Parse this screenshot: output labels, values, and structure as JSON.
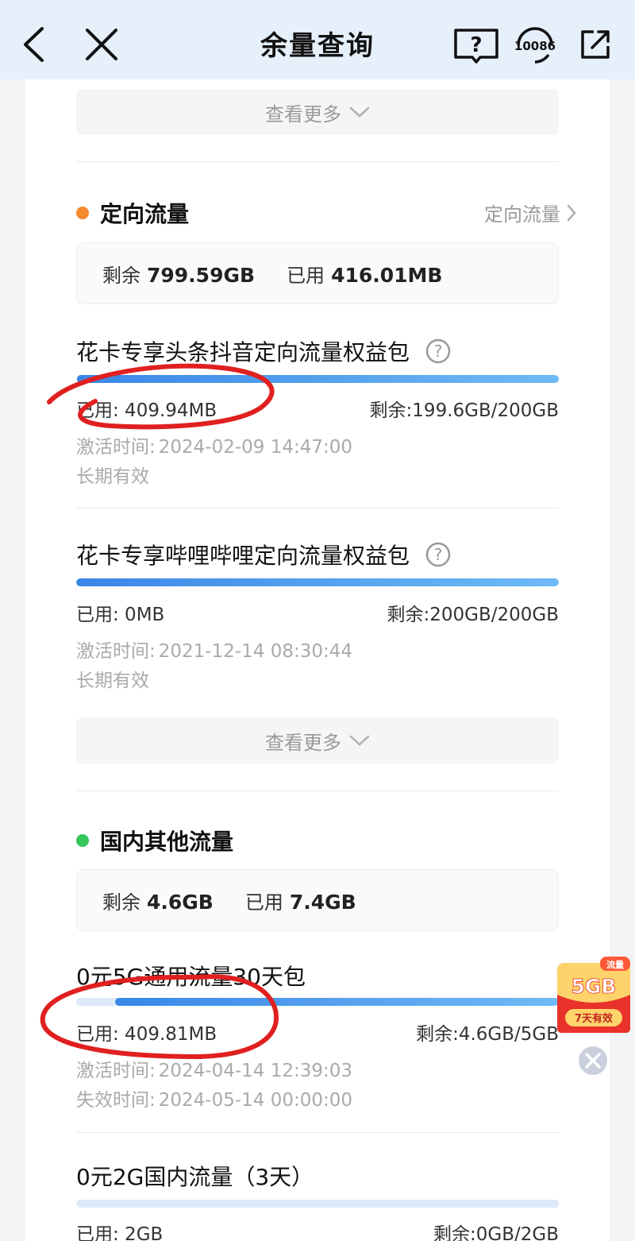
{
  "header": {
    "title": "余量查询",
    "hotline_label": "10086",
    "back_icon": "back-arrow-icon",
    "close_icon": "close-icon",
    "help_icon": "help-book-icon",
    "share_icon": "share-icon"
  },
  "view_more_label": "查看更多",
  "directional": {
    "title": "定向流量",
    "dot_color": "#f5892e",
    "link_label": "定向流量",
    "summary": {
      "remain_label": "剩余",
      "remain_value": "799.59GB",
      "used_label": "已用",
      "used_value": "416.01MB"
    },
    "packages": [
      {
        "name": "花卡专享头条抖音定向流量权益包",
        "used_text": "已用: 409.94MB",
        "remain_text": "剩余:199.6GB/200GB",
        "remaining_fraction": 0.998,
        "meta1_label": "激活时间:",
        "meta1_value": "2024-02-09 14:47:00",
        "meta2": "长期有效"
      },
      {
        "name": "花卡专享哔哩哔哩定向流量权益包",
        "used_text": "已用: 0MB",
        "remain_text": "剩余:200GB/200GB",
        "remaining_fraction": 1.0,
        "meta1_label": "激活时间:",
        "meta1_value": "2021-12-14 08:30:44",
        "meta2": "长期有效"
      }
    ]
  },
  "domestic": {
    "title": "国内其他流量",
    "dot_color": "#34c759",
    "summary": {
      "remain_label": "剩余",
      "remain_value": "4.6GB",
      "used_label": "已用",
      "used_value": "7.4GB"
    },
    "packages": [
      {
        "name": "0元5G通用流量30天包",
        "used_text": "已用: 409.81MB",
        "remain_text": "剩余:4.6GB/5GB",
        "remaining_fraction": 0.92,
        "meta1_label": "激活时间:",
        "meta1_value": "2024-04-14 12:39:03",
        "meta2_label": "失效时间:",
        "meta2_value": "2024-05-14 00:00:00"
      },
      {
        "name": "0元2G国内流量（3天）",
        "used_text": "已用: 2GB",
        "remain_text": "剩余:0GB/2GB",
        "remaining_fraction": 0.0
      }
    ]
  },
  "promo": {
    "tag": "流量",
    "amount": "5GB",
    "validity": "7天有效"
  },
  "colors": {
    "accent_blue": "#3a86e8",
    "annotation_red": "#e02020"
  }
}
